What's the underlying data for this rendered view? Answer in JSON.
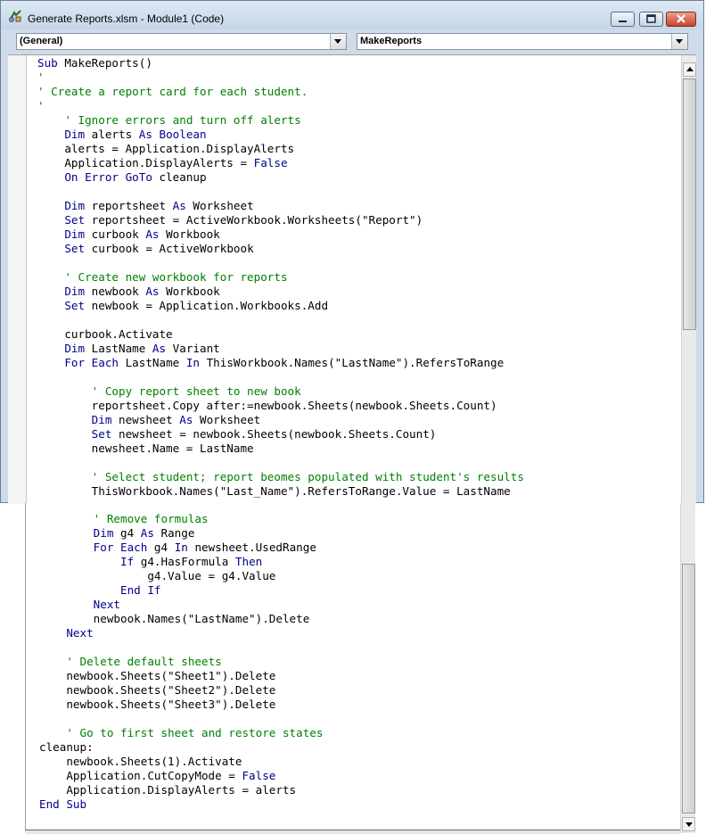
{
  "window": {
    "title": "Generate Reports.xlsm - Module1 (Code)"
  },
  "dropdowns": {
    "object": "(General)",
    "procedure": "MakeReports"
  },
  "code_top": [
    [
      {
        "t": "Sub",
        "c": "kw"
      },
      {
        "t": " MakeReports()"
      }
    ],
    [
      {
        "t": "'",
        "c": "cm"
      }
    ],
    [
      {
        "t": "' Create a report card for each student.",
        "c": "cm"
      }
    ],
    [
      {
        "t": "'",
        "c": "cm"
      }
    ],
    [
      {
        "t": "    "
      },
      {
        "t": "' Ignore errors and turn off alerts",
        "c": "cm"
      }
    ],
    [
      {
        "t": "    "
      },
      {
        "t": "Dim",
        "c": "kw"
      },
      {
        "t": " alerts "
      },
      {
        "t": "As Boolean",
        "c": "kw"
      }
    ],
    [
      {
        "t": "    alerts = Application.DisplayAlerts"
      }
    ],
    [
      {
        "t": "    Application.DisplayAlerts = "
      },
      {
        "t": "False",
        "c": "kw"
      }
    ],
    [
      {
        "t": "    "
      },
      {
        "t": "On Error GoTo",
        "c": "kw"
      },
      {
        "t": " cleanup"
      }
    ],
    [
      {
        "t": ""
      }
    ],
    [
      {
        "t": "    "
      },
      {
        "t": "Dim",
        "c": "kw"
      },
      {
        "t": " reportsheet "
      },
      {
        "t": "As",
        "c": "kw"
      },
      {
        "t": " Worksheet"
      }
    ],
    [
      {
        "t": "    "
      },
      {
        "t": "Set",
        "c": "kw"
      },
      {
        "t": " reportsheet = ActiveWorkbook.Worksheets(\"Report\")"
      }
    ],
    [
      {
        "t": "    "
      },
      {
        "t": "Dim",
        "c": "kw"
      },
      {
        "t": " curbook "
      },
      {
        "t": "As",
        "c": "kw"
      },
      {
        "t": " Workbook"
      }
    ],
    [
      {
        "t": "    "
      },
      {
        "t": "Set",
        "c": "kw"
      },
      {
        "t": " curbook = ActiveWorkbook"
      }
    ],
    [
      {
        "t": ""
      }
    ],
    [
      {
        "t": "    "
      },
      {
        "t": "' Create new workbook for reports",
        "c": "cm"
      }
    ],
    [
      {
        "t": "    "
      },
      {
        "t": "Dim",
        "c": "kw"
      },
      {
        "t": " newbook "
      },
      {
        "t": "As",
        "c": "kw"
      },
      {
        "t": " Workbook"
      }
    ],
    [
      {
        "t": "    "
      },
      {
        "t": "Set",
        "c": "kw"
      },
      {
        "t": " newbook = Application.Workbooks.Add"
      }
    ],
    [
      {
        "t": ""
      }
    ],
    [
      {
        "t": "    curbook.Activate"
      }
    ],
    [
      {
        "t": "    "
      },
      {
        "t": "Dim",
        "c": "kw"
      },
      {
        "t": " LastName "
      },
      {
        "t": "As",
        "c": "kw"
      },
      {
        "t": " Variant"
      }
    ],
    [
      {
        "t": "    "
      },
      {
        "t": "For Each",
        "c": "kw"
      },
      {
        "t": " LastName "
      },
      {
        "t": "In",
        "c": "kw"
      },
      {
        "t": " ThisWorkbook.Names(\"LastName\").RefersToRange"
      }
    ],
    [
      {
        "t": ""
      }
    ],
    [
      {
        "t": "        "
      },
      {
        "t": "' Copy report sheet to new book",
        "c": "cm"
      }
    ],
    [
      {
        "t": "        reportsheet.Copy after:=newbook.Sheets(newbook.Sheets.Count)"
      }
    ],
    [
      {
        "t": "        "
      },
      {
        "t": "Dim",
        "c": "kw"
      },
      {
        "t": " newsheet "
      },
      {
        "t": "As",
        "c": "kw"
      },
      {
        "t": " Worksheet"
      }
    ],
    [
      {
        "t": "        "
      },
      {
        "t": "Set",
        "c": "kw"
      },
      {
        "t": " newsheet = newbook.Sheets(newbook.Sheets.Count)"
      }
    ],
    [
      {
        "t": "        newsheet.Name = LastName"
      }
    ],
    [
      {
        "t": ""
      }
    ],
    [
      {
        "t": "        "
      },
      {
        "t": "' Select student; report beomes populated with student's results",
        "c": "cm"
      }
    ],
    [
      {
        "t": "        ThisWorkbook.Names(\"Last_Name\").RefersToRange.Value = LastName"
      }
    ]
  ],
  "code_bottom": [
    [
      {
        "t": "        "
      },
      {
        "t": "' Remove formulas",
        "c": "cm"
      }
    ],
    [
      {
        "t": "        "
      },
      {
        "t": "Dim",
        "c": "kw"
      },
      {
        "t": " g4 "
      },
      {
        "t": "As",
        "c": "kw"
      },
      {
        "t": " Range"
      }
    ],
    [
      {
        "t": "        "
      },
      {
        "t": "For Each",
        "c": "kw"
      },
      {
        "t": " g4 "
      },
      {
        "t": "In",
        "c": "kw"
      },
      {
        "t": " newsheet.UsedRange"
      }
    ],
    [
      {
        "t": "            "
      },
      {
        "t": "If",
        "c": "kw"
      },
      {
        "t": " g4.HasFormula "
      },
      {
        "t": "Then",
        "c": "kw"
      }
    ],
    [
      {
        "t": "                g4.Value = g4.Value"
      }
    ],
    [
      {
        "t": "            "
      },
      {
        "t": "End If",
        "c": "kw"
      }
    ],
    [
      {
        "t": "        "
      },
      {
        "t": "Next",
        "c": "kw"
      }
    ],
    [
      {
        "t": "        newbook.Names(\"LastName\").Delete"
      }
    ],
    [
      {
        "t": "    "
      },
      {
        "t": "Next",
        "c": "kw"
      }
    ],
    [
      {
        "t": ""
      }
    ],
    [
      {
        "t": "    "
      },
      {
        "t": "' Delete default sheets",
        "c": "cm"
      }
    ],
    [
      {
        "t": "    newbook.Sheets(\"Sheet1\").Delete"
      }
    ],
    [
      {
        "t": "    newbook.Sheets(\"Sheet2\").Delete"
      }
    ],
    [
      {
        "t": "    newbook.Sheets(\"Sheet3\").Delete"
      }
    ],
    [
      {
        "t": ""
      }
    ],
    [
      {
        "t": "    "
      },
      {
        "t": "' Go to first sheet and restore states",
        "c": "cm"
      }
    ],
    [
      {
        "t": "cleanup:"
      }
    ],
    [
      {
        "t": "    newbook.Sheets(1).Activate"
      }
    ],
    [
      {
        "t": "    Application.CutCopyMode = "
      },
      {
        "t": "False",
        "c": "kw"
      }
    ],
    [
      {
        "t": "    Application.DisplayAlerts = alerts"
      }
    ],
    [
      {
        "t": "End Sub",
        "c": "kw"
      }
    ]
  ],
  "colors": {
    "keyword": "#00008b",
    "comment": "#008000",
    "text": "#000000"
  },
  "icons": {
    "app": "vba-module-icon",
    "minimize": "minimize-icon",
    "maximize": "maximize-icon",
    "close": "close-icon"
  }
}
